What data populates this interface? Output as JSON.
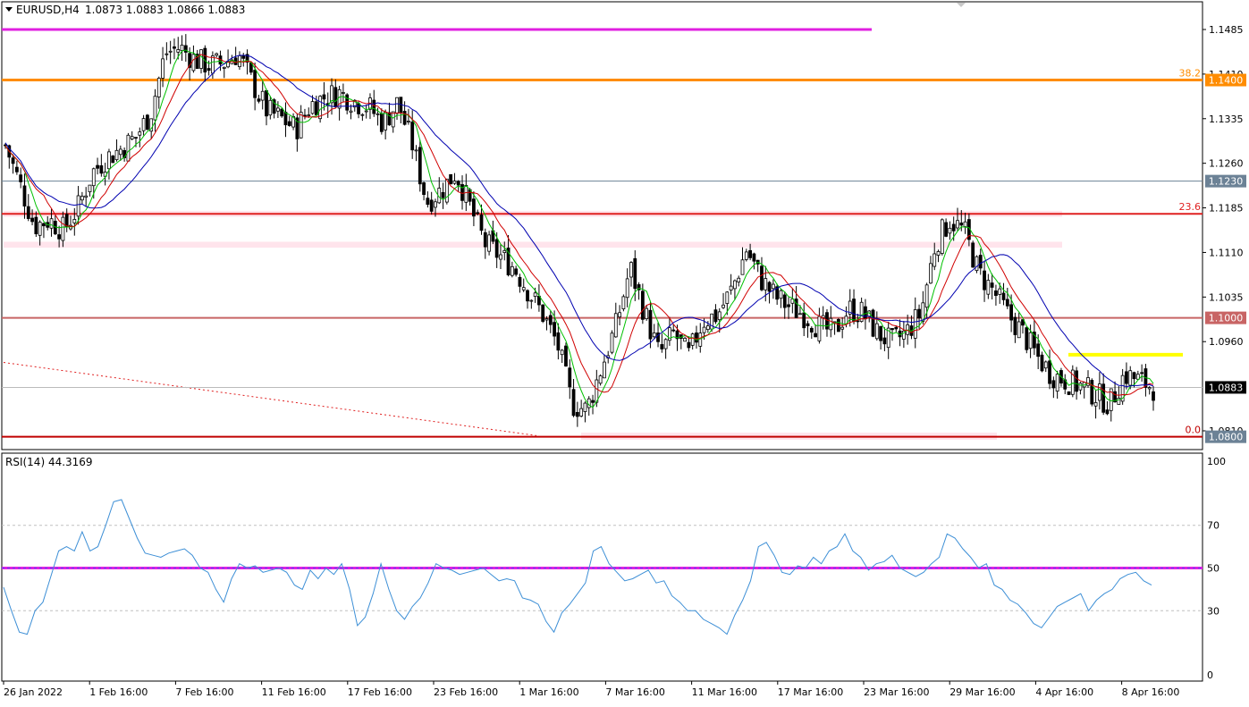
{
  "header": {
    "symbol_timeframe": "EURUSD,H4",
    "ohlc": "1.0873 1.0883 1.0866 1.0883"
  },
  "rsi_header": "RSI(14) 44.3169",
  "colors": {
    "bull": "#000000",
    "bear": "#000000",
    "ma_fast": "#00c000",
    "ma_mid": "#d00000",
    "ma_slow": "#0000b0",
    "rsi_line": "#3d8fd6",
    "resistance_magenta": "#e020e0",
    "fib_orange": "#ff8c00",
    "level_red": "#e02020",
    "level_steel": "#6c8296",
    "level_brown": "#c86464",
    "highlight_yellow": "#ffff00"
  },
  "chart_data": [
    {
      "type": "candlestick",
      "symbol": "EURUSD",
      "timeframe": "H4",
      "ylim": [
        1.0775,
        1.1505
      ],
      "price_ticks": [
        "1.1485",
        "1.1410",
        "1.1335",
        "1.1260",
        "1.1185",
        "1.1110",
        "1.1035",
        "1.0960",
        "1.0810"
      ],
      "x_labels": [
        "26 Jan 2022",
        "1 Feb 16:00",
        "7 Feb 16:00",
        "11 Feb 16:00",
        "17 Feb 16:00",
        "23 Feb 16:00",
        "1 Mar 16:00",
        "7 Mar 16:00",
        "11 Mar 16:00",
        "17 Mar 16:00",
        "23 Mar 16:00",
        "29 Mar 16:00",
        "4 Apr 16:00",
        "8 Apr 16:00"
      ],
      "close_path": [
        1.129,
        1.1225,
        1.1155,
        1.1165,
        1.1148,
        1.1185,
        1.1245,
        1.127,
        1.1285,
        1.1305,
        1.1345,
        1.1445,
        1.1455,
        1.1435,
        1.1425,
        1.1428,
        1.1445,
        1.1395,
        1.1348,
        1.1335,
        1.1318,
        1.1358,
        1.1372,
        1.1378,
        1.1365,
        1.1355,
        1.1328,
        1.1362,
        1.1292,
        1.1195,
        1.1215,
        1.1245,
        1.1185,
        1.1125,
        1.1105,
        1.1085,
        1.1045,
        1.1005,
        1.0955,
        1.0855,
        1.0845,
        1.0915,
        1.0985,
        1.1085,
        1.1008,
        1.0938,
        1.0975,
        1.0935,
        1.0995,
        1.1005,
        1.1048,
        1.1115,
        1.1065,
        1.1035,
        1.1018,
        1.1005,
        1.0985,
        1.0975,
        1.1015,
        1.1008,
        1.0975,
        1.0958,
        1.0975,
        1.1008,
        1.1125,
        1.1165,
        1.1145,
        1.1075,
        1.1045,
        1.1005,
        1.0975,
        1.0935,
        1.0905,
        1.0895,
        1.0885,
        1.0872,
        1.0855,
        1.0905,
        1.0895,
        1.0883
      ],
      "moving_averages": [
        {
          "name": "MA fast",
          "color": "#00c000"
        },
        {
          "name": "MA mid",
          "color": "#d00000"
        },
        {
          "name": "MA slow",
          "color": "#0000b0"
        }
      ],
      "levels": [
        {
          "price": 1.1485,
          "label": "",
          "color": "#e020e0",
          "extent": "left-partial"
        },
        {
          "price": 1.14,
          "label": "1.1400",
          "fib": "38.2",
          "color": "#ff8c00",
          "badge_color": "#ff8c00"
        },
        {
          "price": 1.123,
          "label": "1.1230",
          "color": "#6c8296",
          "badge_color": "#6c8296"
        },
        {
          "price": 1.1175,
          "label": "",
          "fib": "23.6",
          "color": "#e02020"
        },
        {
          "price": 1.1,
          "label": "1.1000",
          "color": "#c86464",
          "badge_color": "#c86464"
        },
        {
          "price": 1.08,
          "label": "1.0800",
          "fib": "0.0",
          "color": "#c00000",
          "badge_color": "#6c8296"
        },
        {
          "price": 1.0883,
          "label": "1.0883",
          "color": "#bbbbbb",
          "badge_color": "#000000",
          "current": true
        },
        {
          "price": 1.0938,
          "label": "",
          "color": "#ffff00",
          "extent": "short"
        }
      ],
      "zones": [
        {
          "from": 1.117,
          "to": 1.118,
          "color": "#ffe4ec"
        },
        {
          "from": 1.1118,
          "to": 1.1128,
          "color": "#ffe4ec"
        },
        {
          "from": 1.0795,
          "to": 1.0807,
          "color": "#ffe4ec"
        }
      ],
      "trendline": {
        "from_price": 1.0925,
        "to_price": 1.0802,
        "style": "dotted",
        "color": "#e02020"
      }
    },
    {
      "type": "line",
      "indicator": "RSI(14)",
      "value": "44.3169",
      "ylim": [
        0,
        100
      ],
      "y_ticks": [
        "100",
        "70",
        "50",
        "30",
        "0"
      ],
      "levels": [
        70,
        50,
        30
      ],
      "path": [
        41,
        30,
        20,
        19,
        30,
        34,
        46,
        58,
        60,
        58,
        67,
        58,
        60,
        70,
        81,
        82,
        73,
        64,
        57,
        56,
        55,
        57,
        58,
        59,
        56,
        50,
        48,
        40,
        34,
        45,
        52,
        50,
        51,
        48,
        49,
        50,
        48,
        42,
        40,
        49,
        45,
        50,
        47,
        52,
        40,
        23,
        27,
        38,
        52,
        40,
        30,
        26,
        32,
        36,
        43,
        52,
        50,
        49,
        47,
        48,
        49,
        50,
        47,
        44,
        45,
        44,
        36,
        35,
        33,
        25,
        20,
        29,
        33,
        38,
        43,
        58,
        60,
        52,
        48,
        44,
        45,
        47,
        49,
        43,
        44,
        37,
        34,
        30,
        30,
        26,
        24,
        22,
        19,
        28,
        35,
        44,
        60,
        62,
        56,
        48,
        47,
        51,
        50,
        55,
        52,
        58,
        60,
        66,
        58,
        55,
        49,
        52,
        53,
        56,
        50,
        48,
        46,
        48,
        52,
        55,
        66,
        64,
        59,
        55,
        50,
        52,
        42,
        40,
        35,
        33,
        29,
        24,
        22,
        27,
        32,
        34,
        36,
        38,
        30,
        35,
        38,
        40,
        45,
        47,
        48,
        44,
        42
      ]
    }
  ]
}
